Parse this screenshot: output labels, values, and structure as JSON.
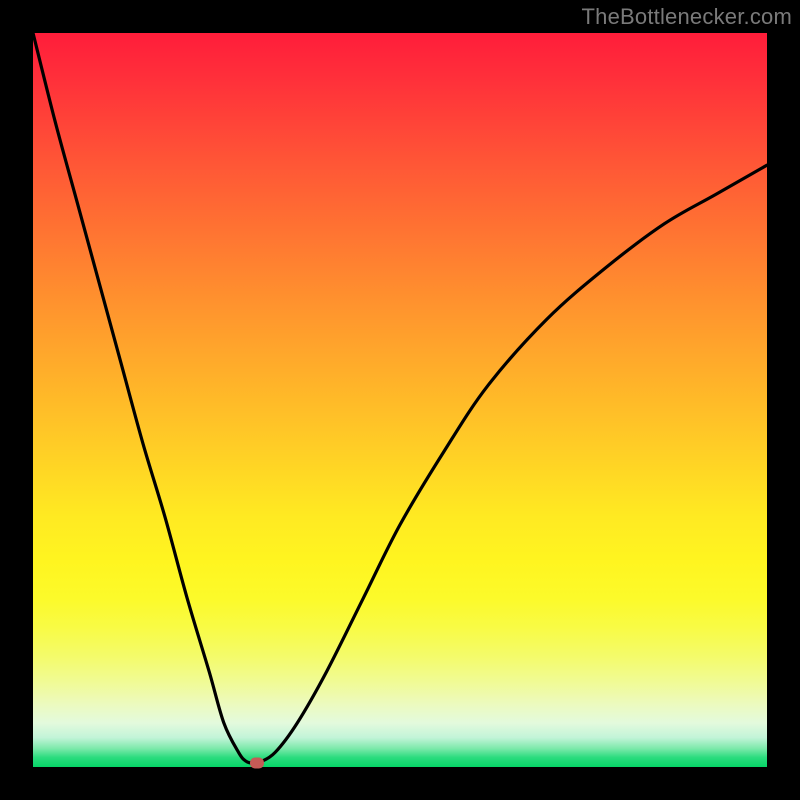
{
  "watermark": "TheBottlenecker.com",
  "chart_data": {
    "type": "line",
    "title": "",
    "xlabel": "",
    "ylabel": "",
    "xlim": [
      0,
      100
    ],
    "ylim": [
      0,
      100
    ],
    "background_gradient": {
      "top": "#ff1d3a",
      "mid": "#ffea22",
      "bottom": "#06d567"
    },
    "series": [
      {
        "name": "bottleneck-curve",
        "x": [
          0,
          3,
          6,
          9,
          12,
          15,
          18,
          21,
          24,
          26,
          28,
          29,
          30,
          31,
          33,
          36,
          40,
          45,
          50,
          56,
          62,
          70,
          78,
          86,
          93,
          100
        ],
        "y": [
          100,
          88,
          77,
          66,
          55,
          44,
          34,
          23,
          13,
          6,
          2,
          0.8,
          0.5,
          0.7,
          2,
          6,
          13,
          23,
          33,
          43,
          52,
          61,
          68,
          74,
          78,
          82
        ]
      }
    ],
    "marker": {
      "x": 30.5,
      "y": 0.5,
      "color": "#c65a56"
    }
  }
}
